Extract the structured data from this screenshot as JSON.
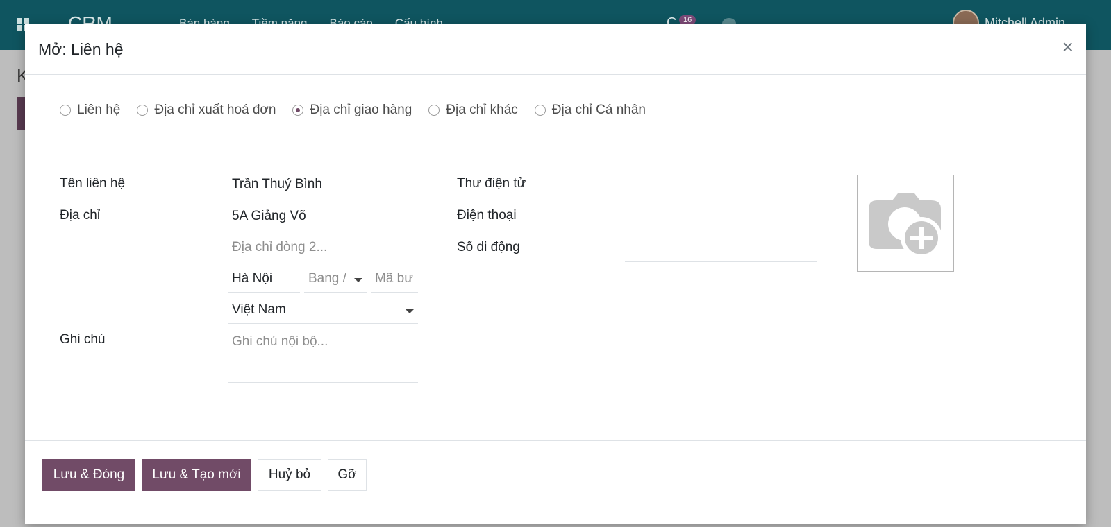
{
  "navbar": {
    "brand": "CRM",
    "menu": [
      "Bán hàng",
      "Tiềm năng",
      "Báo cáo",
      "Cấu hình"
    ],
    "badge_count": "16",
    "user_name": "Mitchell Admin"
  },
  "background": {
    "page_title": "K"
  },
  "modal": {
    "title": "Mở: Liên hệ",
    "close_symbol": "×",
    "address_types": [
      {
        "label": "Liên hệ",
        "checked": false
      },
      {
        "label": "Địa chỉ xuất hoá đơn",
        "checked": false
      },
      {
        "label": "Địa chỉ giao hàng",
        "checked": true
      },
      {
        "label": "Địa chỉ khác",
        "checked": false
      },
      {
        "label": "Địa chỉ Cá nhân",
        "checked": false
      }
    ],
    "left_labels": {
      "contact_name": "Tên liên hệ",
      "address": "Địa chỉ",
      "notes": "Ghi chú"
    },
    "right_labels": {
      "email": "Thư điện tử",
      "phone": "Điện thoại",
      "mobile": "Số di động"
    },
    "fields": {
      "contact_name": "Trần Thuý Bình",
      "street": "5A Giảng Võ",
      "street2_placeholder": "Địa chỉ dòng 2...",
      "city": "Hà Nội",
      "state_placeholder": "Bang /",
      "zip_placeholder": "Mã bư",
      "country": "Việt Nam",
      "notes_placeholder": "Ghi chú nội bộ...",
      "email": "",
      "phone": "",
      "mobile": ""
    },
    "photo_icon": "camera-plus-icon",
    "footer": {
      "save_close": "Lưu & Đóng",
      "save_new": "Lưu & Tạo mới",
      "cancel": "Huỷ bỏ",
      "discard": "Gỡ"
    }
  },
  "colors": {
    "navbar": "#0f5560",
    "primary": "#714b67"
  }
}
